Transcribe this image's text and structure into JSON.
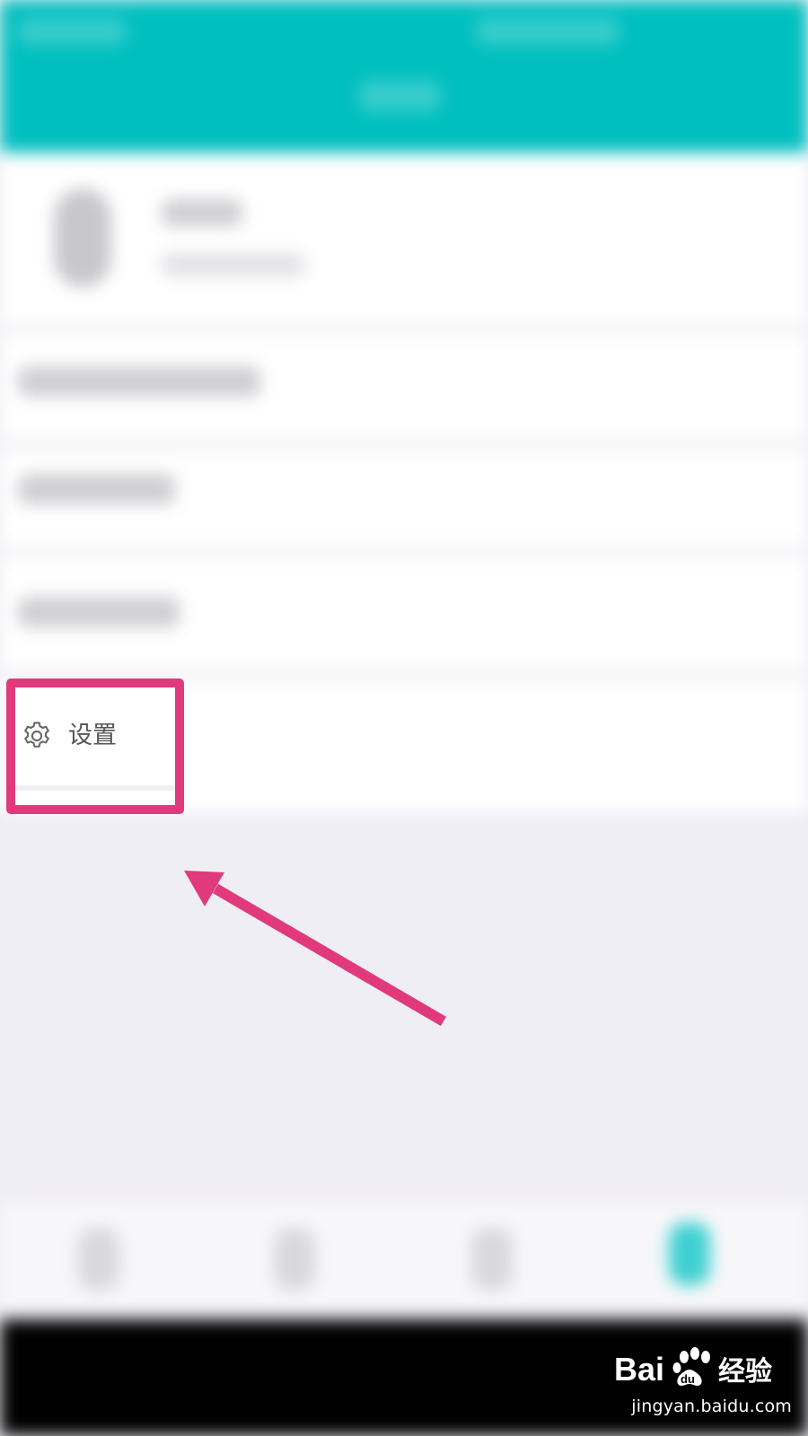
{
  "settings_item": {
    "label": "设置",
    "icon": "gear-icon"
  },
  "annotation": {
    "highlight_color": "#e03a7c",
    "arrow_color": "#e03a7c"
  },
  "colors": {
    "header": "#00bfbf",
    "page_background": "#f0eef5",
    "row_background": "#ffffff",
    "nav_active": "#3fd0d2",
    "system_bar": "#000000"
  },
  "watermark": {
    "brand": "Baidu 经验",
    "domain": "jingyan.baidu.com"
  }
}
